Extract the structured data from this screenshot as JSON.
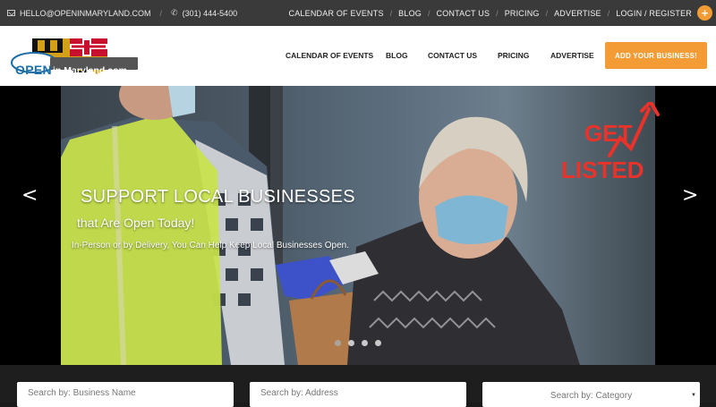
{
  "topbar": {
    "email": "HELLO@OPENINMARYLAND.COM",
    "phone": "(301) 444-5400",
    "links": [
      "CALENDAR OF EVENTS",
      "BLOG",
      "CONTACT US",
      "PRICING",
      "ADVERTISE",
      "LOGIN / REGISTER"
    ],
    "plus": "+"
  },
  "header": {
    "logo": {
      "word1": "OPEN",
      "word2": "in Maryland.com"
    },
    "nav": [
      "CALENDAR OF EVENTS",
      "BLOG",
      "CONTACT US",
      "PRICING",
      "ADVERTISE"
    ],
    "cta": "ADD YOUR BUSINESS!"
  },
  "hero": {
    "title": "SUPPORT LOCAL BUSINESSES",
    "subtitle": "that Are Open Today!",
    "tagline": "In-Person or by Delivery, You Can Help Keep Local Businesses Open.",
    "prev": "<",
    "next": ">",
    "slide_count": 4,
    "overlay_text": [
      "GET",
      "LISTED"
    ]
  },
  "search": {
    "business_placeholder": "Search by: Business Name",
    "address_placeholder": "Search by: Address",
    "category_placeholder": "Search by: Category"
  },
  "colors": {
    "accent": "#f39c35",
    "topbar_bg": "#3a3a3a",
    "annotation_red": "#e8322a"
  }
}
